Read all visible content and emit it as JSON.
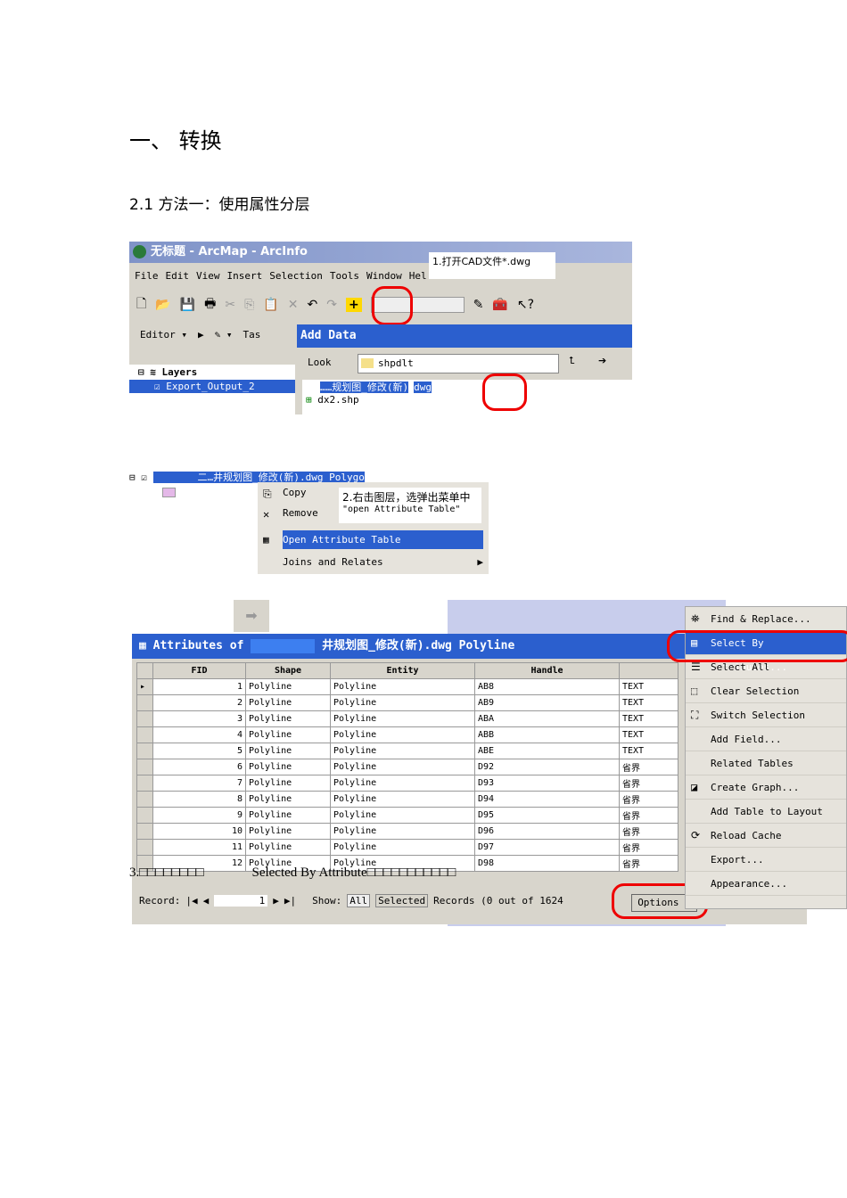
{
  "heading": "一、  转换",
  "subheading": "2.1 方法一：使用属性分层",
  "shot1": {
    "window_title": "无标题 - ArcMap - ArcInfo",
    "menu": [
      "File",
      "Edit",
      "View",
      "Insert",
      "Selection",
      "Tools",
      "Window",
      "Hel"
    ],
    "callout": "1.打开CAD文件*.dwg",
    "editor": "Editor ▾",
    "task": "Tas",
    "dialog_title": "Add Data",
    "look_label": "Look",
    "look_value": "shpdlt",
    "toc_root": "Layers",
    "toc_layer": "Export_Output_2",
    "files": [
      "……规划图_修改(新)",
      "dx2.shp"
    ],
    "file_ext": "dwg"
  },
  "shot2": {
    "layer": "二…井规划图_修改(新).dwg Polygo",
    "menu": [
      "Copy",
      "Remove",
      "Open Attribute Table",
      "Joins and Relates"
    ],
    "callout_line1": "2.右击图层，选弹出菜单中",
    "callout_line2": "\"open Attribute Table\""
  },
  "shot3": {
    "title": "Attributes of",
    "title_name": "井规划图_修改(新).dwg Polyline",
    "columns": [
      "FID",
      "Shape",
      "Entity",
      "Handle",
      ""
    ],
    "rows": [
      [
        "1",
        "Polyline",
        "Polyline",
        "AB8",
        "TEXT"
      ],
      [
        "2",
        "Polyline",
        "Polyline",
        "AB9",
        "TEXT"
      ],
      [
        "3",
        "Polyline",
        "Polyline",
        "ABA",
        "TEXT"
      ],
      [
        "4",
        "Polyline",
        "Polyline",
        "ABB",
        "TEXT"
      ],
      [
        "5",
        "Polyline",
        "Polyline",
        "ABE",
        "TEXT"
      ],
      [
        "6",
        "Polyline",
        "Polyline",
        "D92",
        "省界"
      ],
      [
        "7",
        "Polyline",
        "Polyline",
        "D93",
        "省界"
      ],
      [
        "8",
        "Polyline",
        "Polyline",
        "D94",
        "省界"
      ],
      [
        "9",
        "Polyline",
        "Polyline",
        "D95",
        "省界"
      ],
      [
        "10",
        "Polyline",
        "Polyline",
        "D96",
        "省界"
      ],
      [
        "11",
        "Polyline",
        "Polyline",
        "D97",
        "省界"
      ],
      [
        "12",
        "Polyline",
        "Polyline",
        "D98",
        "省界"
      ]
    ],
    "overlay_step": "3.□□□□□□□□",
    "overlay_text": "Selected By Attribute□□□□□□□□□□□",
    "record_label": "Record:",
    "record_value": "1",
    "show_label": "Show:",
    "show_all": "All",
    "show_selected": "Selected",
    "records_text": "Records (0 out of 1624",
    "options": "Options ▾",
    "options_menu": [
      "Find & Replace...",
      "Select By Attributes...",
      "Select All",
      "Clear Selection",
      "Switch Selection",
      "Add Field...",
      "Related Tables",
      "Create Graph...",
      "Add Table to Layout",
      "Reload Cache",
      "Export...",
      "Appearance..."
    ]
  }
}
